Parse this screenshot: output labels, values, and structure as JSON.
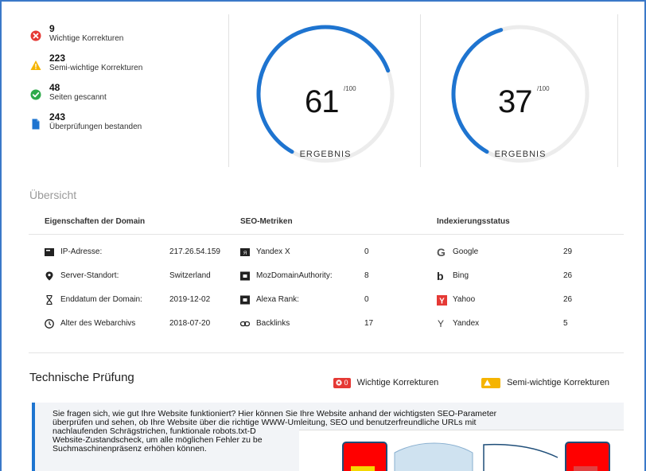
{
  "stats": [
    {
      "value": "9",
      "label": "Wichtige Korrekturen",
      "icon": "error-circle-icon",
      "color": "#e53935"
    },
    {
      "value": "223",
      "label": "Semi-wichtige Korrekturen",
      "icon": "warning-triangle-icon",
      "color": "#f5b400"
    },
    {
      "value": "48",
      "label": "Seiten gescannt",
      "icon": "check-circle-icon",
      "color": "#2eaa4a"
    },
    {
      "value": "243",
      "label": "Überprüfungen bestanden",
      "icon": "document-icon",
      "color": "#1e74d0"
    }
  ],
  "gauges": [
    {
      "score": "61",
      "outof": "/100",
      "label": "ERGEBNIS",
      "fraction": 0.61,
      "color": "#1e74d0"
    },
    {
      "score": "37",
      "outof": "/100",
      "label": "ERGEBNIS",
      "fraction": 0.37,
      "color": "#1e74d0"
    }
  ],
  "overview": {
    "title": "Übersicht",
    "domain": {
      "heading": "Eigenschaften der Domain",
      "rows": [
        {
          "label": "IP-Adresse:",
          "value": "217.26.54.159",
          "icon": "server-icon"
        },
        {
          "label": "Server-Standort:",
          "value": "Switzerland",
          "icon": "location-pin-icon"
        },
        {
          "label": "Enddatum der Domain:",
          "value": "2019-12-02",
          "icon": "hourglass-icon"
        },
        {
          "label": "Alter des Webarchivs",
          "value": "2018-07-20",
          "icon": "clock-icon"
        }
      ]
    },
    "seo": {
      "heading": "SEO-Metriken",
      "rows": [
        {
          "label": "Yandex X",
          "value": "0",
          "icon": "yandex-x-icon"
        },
        {
          "label": "MozDomainAuthority:",
          "value": "8",
          "icon": "moz-icon"
        },
        {
          "label": "Alexa Rank:",
          "value": "0",
          "icon": "alexa-icon"
        },
        {
          "label": "Backlinks",
          "value": "17",
          "icon": "link-icon"
        }
      ]
    },
    "index": {
      "heading": "Indexierungsstatus",
      "rows": [
        {
          "label": "Google",
          "value": "29",
          "icon": "google-icon"
        },
        {
          "label": "Bing",
          "value": "26",
          "icon": "bing-icon"
        },
        {
          "label": "Yahoo",
          "value": "26",
          "icon": "yahoo-icon"
        },
        {
          "label": "Yandex",
          "value": "5",
          "icon": "yandex-icon"
        }
      ]
    }
  },
  "technical": {
    "title": "Technische Prüfung",
    "legend_major_count": "0",
    "legend_major": "Wichtige Korrekturen",
    "legend_minor": "Semi-wichtige Korrekturen",
    "info_lines": [
      "Sie fragen sich, wie gut Ihre Website funktioniert? Hier können Sie Ihre Website anhand der wichtigsten SEO-Parameter",
      "überprüfen und sehen, ob Ihre Website über die richtige WWW-Umleitung, SEO und benutzerfreundliche URLs mit",
      "nachlaufenden Schrägstrichen, funktionale robots.txt-D",
      "Website-Zustandscheck, um alle möglichen Fehler zu be",
      "Suchmaschinenpräsenz erhöhen können."
    ]
  },
  "colors": {
    "accent": "#1e74d0",
    "error": "#e53935",
    "warning": "#f5b400",
    "success": "#2eaa4a"
  }
}
